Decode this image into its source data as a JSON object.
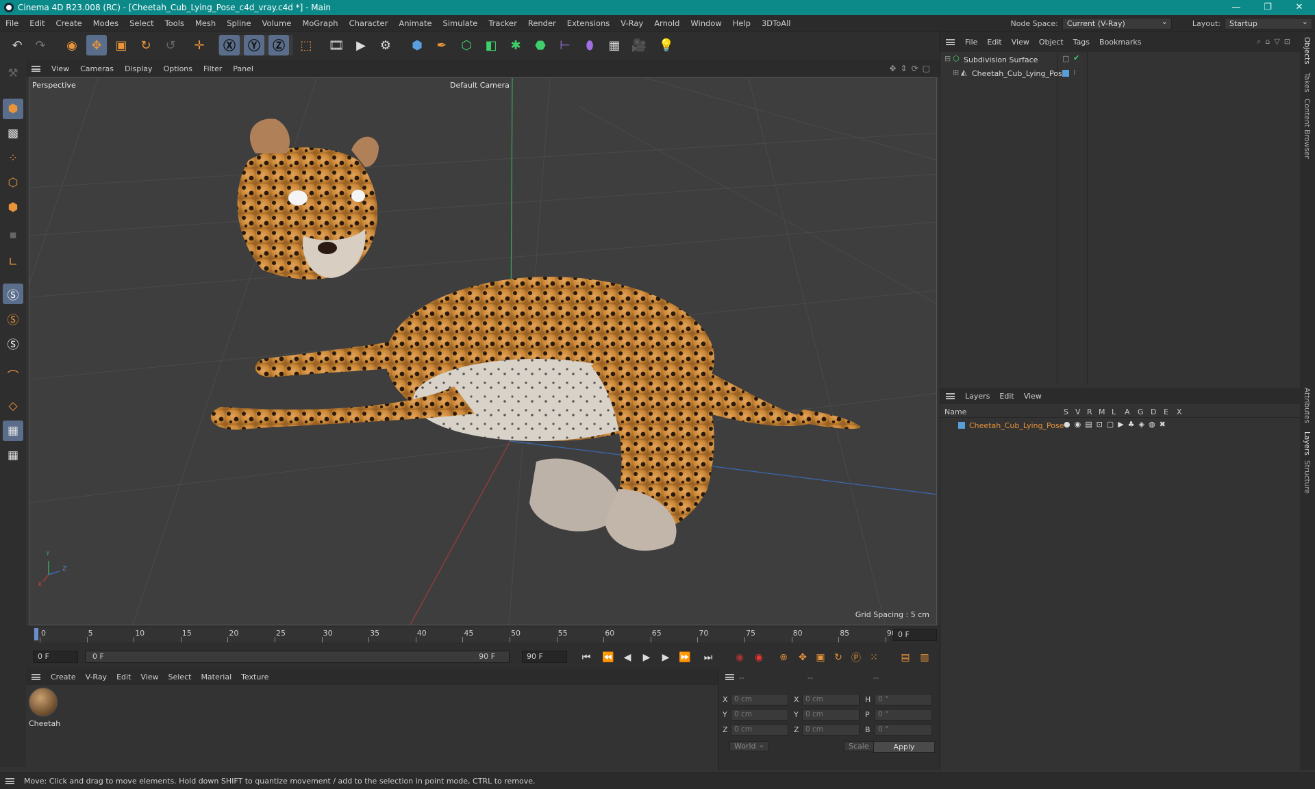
{
  "window": {
    "title": "Cinema 4D R23.008 (RC) - [Cheetah_Cub_Lying_Pose_c4d_vray.c4d *] - Main"
  },
  "menubar": {
    "items": [
      "File",
      "Edit",
      "Create",
      "Modes",
      "Select",
      "Tools",
      "Mesh",
      "Spline",
      "Volume",
      "MoGraph",
      "Character",
      "Animate",
      "Simulate",
      "Tracker",
      "Render",
      "Extensions",
      "V-Ray",
      "Arnold",
      "Window",
      "Help",
      "3DToAll"
    ],
    "node_space_label": "Node Space:",
    "node_space_value": "Current (V-Ray)",
    "layout_label": "Layout:",
    "layout_value": "Startup"
  },
  "viewport": {
    "menu": [
      "View",
      "Cameras",
      "Display",
      "Options",
      "Filter",
      "Panel"
    ],
    "view_name": "Perspective",
    "camera": "Default Camera",
    "grid_spacing": "Grid Spacing : 5 cm",
    "axis_x": "X",
    "axis_y": "Y",
    "axis_z": "Z"
  },
  "timeline": {
    "ticks": [
      "0",
      "5",
      "10",
      "15",
      "20",
      "25",
      "30",
      "35",
      "40",
      "45",
      "50",
      "55",
      "60",
      "65",
      "70",
      "75",
      "80",
      "85",
      "90"
    ],
    "current_frame": "0 F",
    "start_field": "0 F",
    "range_start": "0 F",
    "range_end": "90 F",
    "end_field": "90 F"
  },
  "material_manager": {
    "menu": [
      "Create",
      "V-Ray",
      "Edit",
      "View",
      "Select",
      "Material",
      "Texture"
    ],
    "materials": [
      {
        "name": "Cheetah"
      }
    ]
  },
  "coordinates": {
    "header": [
      "--",
      "--",
      "--"
    ],
    "rows": [
      {
        "l1": "X",
        "v1": "0 cm",
        "l2": "X",
        "v2": "0 cm",
        "l3": "H",
        "v3": "0 °"
      },
      {
        "l1": "Y",
        "v1": "0 cm",
        "l2": "Y",
        "v2": "0 cm",
        "l3": "P",
        "v3": "0 °"
      },
      {
        "l1": "Z",
        "v1": "0 cm",
        "l2": "Z",
        "v2": "0 cm",
        "l3": "B",
        "v3": "0 °"
      }
    ],
    "space": "World",
    "mode": "Scale",
    "apply": "Apply"
  },
  "object_manager": {
    "menu": [
      "File",
      "Edit",
      "View",
      "Object",
      "Tags",
      "Bookmarks"
    ],
    "objects": [
      {
        "name": "Subdivision Surface"
      },
      {
        "name": "Cheetah_Cub_Lying_Pose"
      }
    ]
  },
  "layer_manager": {
    "menu": [
      "Layers",
      "Edit",
      "View"
    ],
    "columns": [
      "Name",
      "S",
      "V",
      "R",
      "M",
      "L",
      "A",
      "G",
      "D",
      "E",
      "X"
    ],
    "layers": [
      {
        "name": "Cheetah_Cub_Lying_Pose"
      }
    ]
  },
  "side_tabs": [
    "Objects",
    "Takes",
    "Content Browser",
    "Attributes",
    "Layers",
    "Structure"
  ],
  "status": {
    "text": "Move: Click and drag to move elements. Hold down SHIFT to quantize movement / add to the selection in point mode, CTRL to remove."
  },
  "colors": {
    "accent": "#0c8a8a",
    "selected": "#5a6e8c",
    "orange": "#e8943a",
    "layer_text": "#e8943a"
  }
}
